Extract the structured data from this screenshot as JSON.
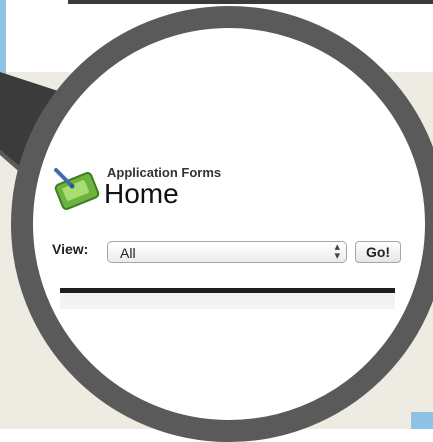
{
  "header": {
    "app_label": "Application Forms",
    "page_title": "Home"
  },
  "view_filter": {
    "label": "View:",
    "selected": "All",
    "go_label": "Go!"
  },
  "colors": {
    "lens_ring": "#5a5a5a",
    "background": "#eeebe2",
    "accent_blue": "#8fc3e6",
    "icon_green": "#7cc23a"
  },
  "icons": {
    "app_icon": "pda-tablet-icon",
    "select_arrows": "updown-arrows-icon"
  }
}
